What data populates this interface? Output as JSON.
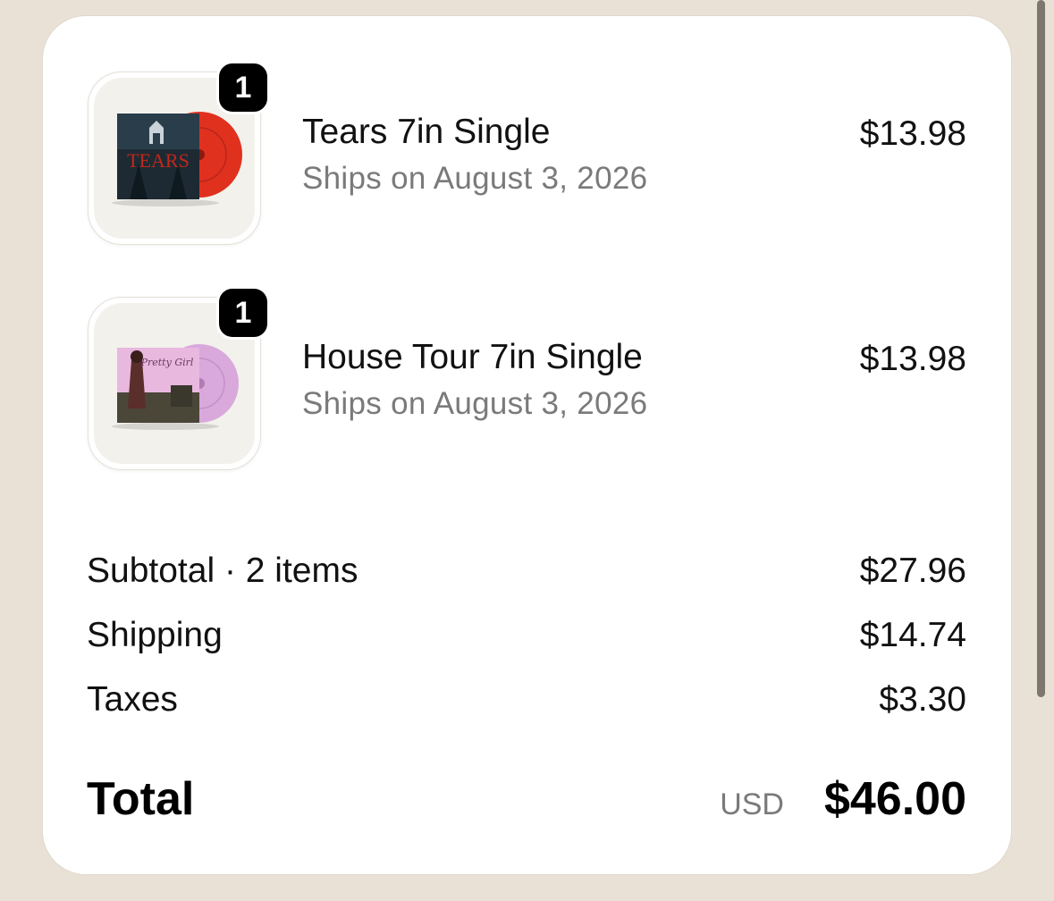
{
  "items": [
    {
      "quantity": "1",
      "title": "Tears 7in Single",
      "ships": "Ships on August 3, 2026",
      "price": "$13.98",
      "art_text": "TEARS",
      "vinyl_color": "#e0311f"
    },
    {
      "quantity": "1",
      "title": "House Tour 7in Single",
      "ships": "Ships on August 3, 2026",
      "price": "$13.98",
      "art_text": "Pretty Girl",
      "vinyl_color": "#d9a9dc"
    }
  ],
  "summary": {
    "subtotal_label": "Subtotal · 2 items",
    "subtotal_value": "$27.96",
    "shipping_label": "Shipping",
    "shipping_value": "$14.74",
    "taxes_label": "Taxes",
    "taxes_value": "$3.30"
  },
  "total": {
    "label": "Total",
    "currency": "USD",
    "value": "$46.00"
  },
  "colors": {
    "background": "#e9e1d5",
    "card": "#ffffff",
    "muted_text": "#7a7a7a",
    "badge": "#000000"
  }
}
